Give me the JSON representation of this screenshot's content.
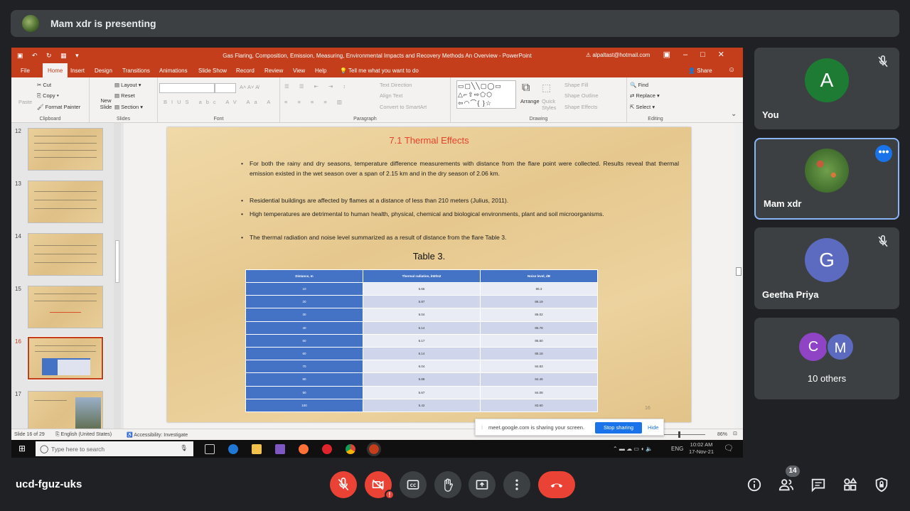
{
  "presenter": {
    "text": "Mam xdr is presenting"
  },
  "ppt": {
    "title": "Gas Flaring, Composition, Emission, Measuring, Environmental Impacts and Recovery Methods An Overview  -  PowerPoint",
    "account": "alpaltast@hotmail.com",
    "menu": [
      "File",
      "Home",
      "Insert",
      "Design",
      "Transitions",
      "Animations",
      "Slide Show",
      "Record",
      "Review",
      "View",
      "Help"
    ],
    "tell_me": "Tell me what you want to do",
    "share": "Share",
    "ribbon": {
      "paste": "Paste",
      "cut": "Cut",
      "copy": "Copy",
      "format_painter": "Format Painter",
      "clipboard": "Clipboard",
      "new_slide": "New Slide",
      "layout": "Layout",
      "reset": "Reset",
      "section": "Section",
      "slides": "Slides",
      "font": "Font",
      "paragraph": "Paragraph",
      "text_direction": "Text Direction",
      "align_text": "Align Text",
      "convert_smartart": "Convert to SmartArt",
      "arrange": "Arrange",
      "quick_styles": "Quick Styles",
      "shape_fill": "Shape Fill",
      "shape_outline": "Shape Outline",
      "shape_effects": "Shape Effects",
      "drawing": "Drawing",
      "find": "Find",
      "replace": "Replace",
      "select": "Select",
      "editing": "Editing"
    },
    "thumb_numbers": [
      "12",
      "13",
      "14",
      "15",
      "16",
      "17"
    ],
    "slide": {
      "title": "7.1 Thermal Effects",
      "bullets": [
        "For both the rainy and dry seasons, temperature difference measurements with distance from the flare point were collected. Results reveal that thermal emission existed in the wet season over a span of 2.15 km and in the dry season of 2.06 km.",
        "Residential buildings are affected by flames at a distance of less than 210 meters (Julius, 2011).",
        "High temperatures are detrimental to human health, physical, chemical and biological environments, plant and soil microorganisms.",
        "The thermal radiation and noise level  summarized as a result of distance from the flare Table 3."
      ],
      "table_caption": "Table 3.",
      "table_headers": [
        "Distance, m",
        "Thermal radiation, kW/m2",
        "Noise level, dB"
      ],
      "table_rows": [
        [
          "10",
          "5.66",
          "86.3"
        ],
        [
          "20",
          "5.87",
          "86.19"
        ],
        [
          "30",
          "6.04",
          "86.02"
        ],
        [
          "40",
          "6.14",
          "85.78"
        ],
        [
          "50",
          "6.17",
          "85.50"
        ],
        [
          "60",
          "6.14",
          "85.18"
        ],
        [
          "70",
          "6.04",
          "84.83"
        ],
        [
          "80",
          "5.88",
          "84.46"
        ],
        [
          "90",
          "5.67",
          "84.08"
        ],
        [
          "100",
          "5.42",
          "83.60"
        ]
      ],
      "page_number": "16"
    },
    "status": {
      "slide": "Slide 16 of 29",
      "language": "English (United States)",
      "accessibility": "Accessibility: Investigate",
      "zoom": "86%"
    }
  },
  "share_banner": {
    "text": "meet.google.com is sharing your screen.",
    "stop": "Stop sharing",
    "hide": "Hide"
  },
  "taskbar": {
    "search": "Type here to search",
    "lang": "ENG",
    "time": "10:02 AM",
    "date": "17-Nov-21"
  },
  "participants": [
    {
      "name": "You",
      "initial": "A",
      "color": "#1e7b34"
    },
    {
      "name": "Mam xdr"
    },
    {
      "name": "Geetha Priya",
      "initial": "G",
      "color": "#5c6bc0"
    },
    {
      "name": "10 others",
      "initials": [
        "C",
        "M"
      ],
      "colors": [
        "#8e44c4",
        "#5c6bc0"
      ]
    }
  ],
  "meeting_code": "ucd-fguz-uks",
  "people_count": "14",
  "icons": [
    "mic-off-icon",
    "camera-off-icon",
    "captions-icon",
    "raise-hand-icon",
    "present-icon",
    "more-icon",
    "end-call-icon",
    "info-icon",
    "people-icon",
    "chat-icon",
    "activities-icon",
    "host-controls-icon"
  ]
}
